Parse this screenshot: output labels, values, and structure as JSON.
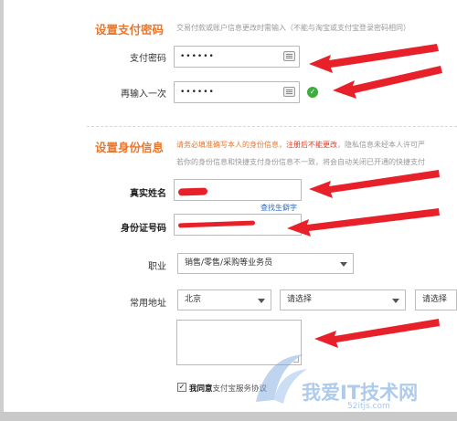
{
  "payment_password_section": {
    "title": "设置支付密码",
    "hint": "交易付款或账户信息更改时需输入（不能与淘宝或支付宝登录密码相同）",
    "password_label": "支付密码",
    "password_value": "••••••",
    "confirm_label": "再输入一次",
    "confirm_value": "••••••"
  },
  "identity_section": {
    "title": "设置身份信息",
    "hint_line1_part1": "请务必填准确写本人的身份信息，",
    "hint_line1_warn": "注册后不能更改",
    "hint_line1_part2": "，隐私信息未经本人许可严",
    "hint_line2": "若你的身份信息和快捷支付身份信息不一致，将会自动关闭已开通的快捷支付",
    "real_name_label": "真实姓名",
    "rare_char_link": "查找生僻字",
    "id_number_label": "身份证号码",
    "occupation_label": "职业",
    "occupation_value": "销售/零售/采购等业务员",
    "address_label": "常用地址",
    "province_value": "北京",
    "city_value": "请选择",
    "district_value": "请选择",
    "agree_bold": "我同意",
    "agree_text": "支付宝服务协议"
  },
  "watermark": {
    "text": "我爱IT技术网",
    "url": "52itjs.com"
  },
  "colors": {
    "section_title": "#e8772e",
    "annotation_red": "#e8202a",
    "check_green": "#3eac3e",
    "link_blue": "#2a6cc2"
  }
}
